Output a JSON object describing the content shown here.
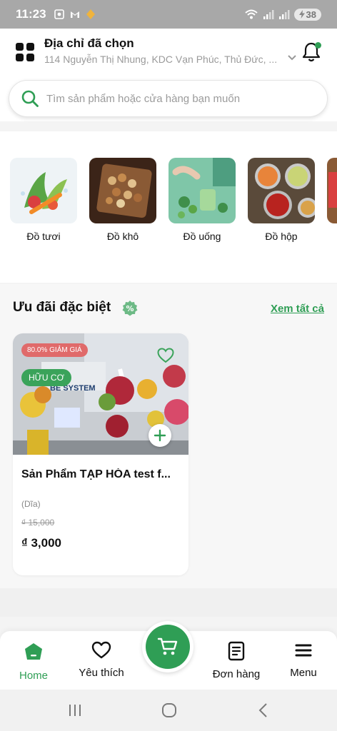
{
  "status": {
    "time": "11:23",
    "battery": "38"
  },
  "header": {
    "address_title": "Địa chỉ đã chọn",
    "address_line": "114 Nguyễn Thị Nhung, KDC Vạn Phúc, Thủ Đức, ..."
  },
  "search": {
    "placeholder": "Tìm sản phẩm hoặc cửa hàng bạn muốn"
  },
  "categories": [
    {
      "label": "Đồ tươi",
      "icon": "fresh-vegetables-image"
    },
    {
      "label": "Đồ khô",
      "icon": "dry-nuts-image"
    },
    {
      "label": "Đồ uống",
      "icon": "drinks-image"
    },
    {
      "label": "Đồ hộp",
      "icon": "canned-food-image"
    }
  ],
  "deals": {
    "title": "Ưu đãi đặc biệt",
    "see_all": "Xem tất cả",
    "product": {
      "discount_tag": "80.0% GIẢM GIÁ",
      "organic_tag": "HỮU CƠ",
      "name": "Sản Phẩm TẠP HÓA test f...",
      "unit": "(Dĩa)",
      "old_price": "₫ 15,000",
      "new_price": "₫ 3,000",
      "image_text": "BE SYSTEM"
    }
  },
  "bottom_nav": {
    "home": "Home",
    "favorites": "Yêu thích",
    "orders": "Đơn hàng",
    "menu": "Menu"
  },
  "colors": {
    "accent": "#2f9e55",
    "discount": "#e06a6a"
  }
}
